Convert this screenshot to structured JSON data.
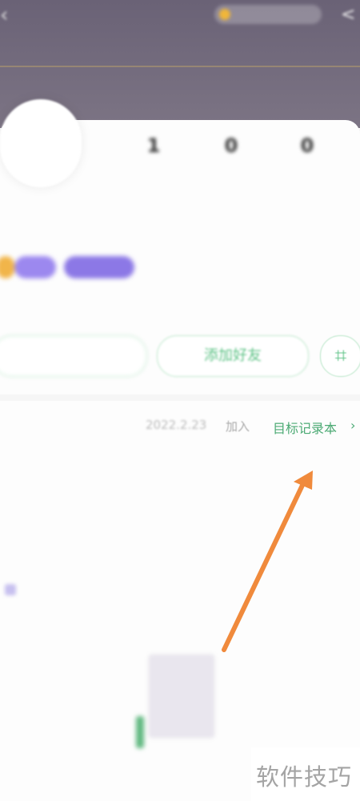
{
  "header": {
    "back_icon": "chevron-left-icon",
    "top_pill_text": "",
    "share_icon": "share-icon"
  },
  "profile": {
    "name": "",
    "stats": [
      {
        "value": "1",
        "label": ""
      },
      {
        "value": "0",
        "label": ""
      },
      {
        "value": "0",
        "label": ""
      }
    ],
    "meta": ""
  },
  "actions": {
    "left_button": "",
    "add_friend": "添加好友",
    "qr_icon": "qr-code-icon"
  },
  "goal": {
    "owner": "",
    "date": "2022.2.23",
    "joined": "加入",
    "link": "目标记录本",
    "chevron": "›"
  },
  "stats2": [
    {
      "label": "",
      "value": ""
    },
    {
      "label": "",
      "value": ""
    }
  ],
  "record": {
    "title": "",
    "more": ""
  },
  "watermark": "软件技巧",
  "colors": {
    "header": "#6e6679",
    "accent_green": "#4caa74",
    "annotation_arrow": "#f08a3c"
  }
}
